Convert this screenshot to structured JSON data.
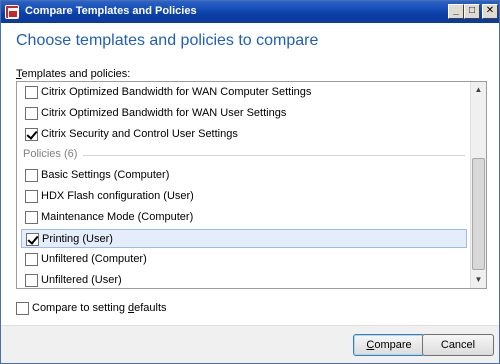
{
  "window": {
    "title": "Compare Templates and Policies",
    "buttons": {
      "minimize": "_",
      "maximize": "□",
      "close": "✕"
    }
  },
  "heading": "Choose templates and policies to compare",
  "list": {
    "label_pre": "",
    "label_accel": "T",
    "label_post": "emplates and policies:",
    "items": [
      {
        "label": "Citrix Optimized Bandwidth for WAN Computer Settings",
        "checked": false
      },
      {
        "label": "Citrix Optimized Bandwidth for WAN User Settings",
        "checked": false
      },
      {
        "label": "Citrix Security and Control User Settings",
        "checked": true
      }
    ],
    "group_header": "Policies (6)",
    "policies": [
      {
        "label": "Basic Settings (Computer)",
        "checked": false
      },
      {
        "label": "HDX Flash configuration (User)",
        "checked": false
      },
      {
        "label": "Maintenance Mode (Computer)",
        "checked": false
      },
      {
        "label": "Printing (User)",
        "checked": true,
        "selected": true
      },
      {
        "label": "Unfiltered (Computer)",
        "checked": false
      },
      {
        "label": "Unfiltered (User)",
        "checked": false
      }
    ]
  },
  "defaults_option": {
    "label_pre": "Compare to setting ",
    "label_accel": "d",
    "label_post": "efaults",
    "checked": false
  },
  "footer": {
    "compare_pre": "",
    "compare_accel": "C",
    "compare_post": "ompare",
    "cancel": "Cancel"
  },
  "colors": {
    "heading": "#1f5fb7",
    "titlebar": "#0a3fa8",
    "selection": "#e4eefb"
  }
}
